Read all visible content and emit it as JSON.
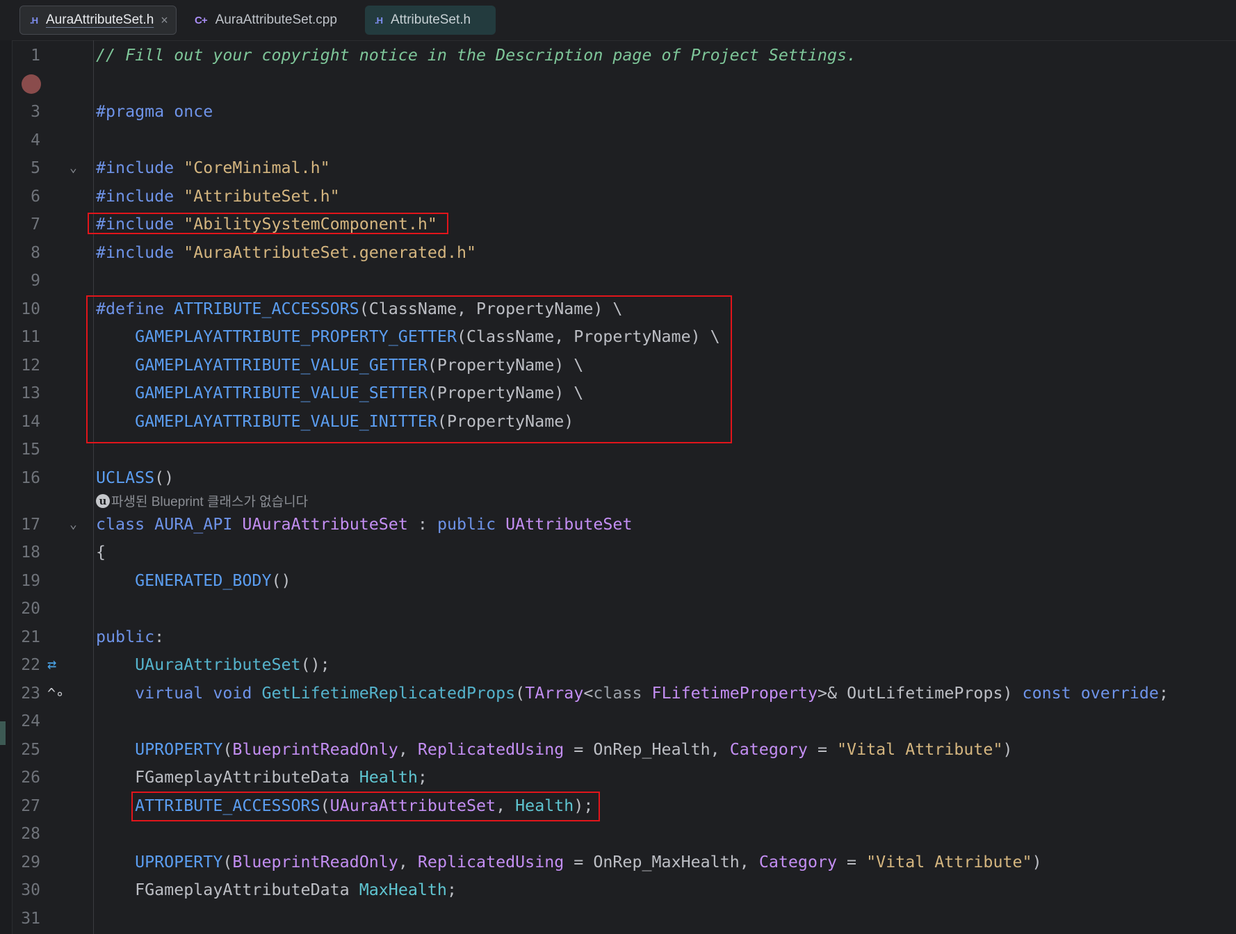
{
  "tabs": [
    {
      "icon": ".H",
      "label": "AuraAttributeSet.h",
      "close": "×",
      "state": "active"
    },
    {
      "icon": "C+",
      "label": "AuraAttributeSet.cpp",
      "state": "normal"
    },
    {
      "icon": ".H",
      "label": "AttributeSet.h",
      "state": "tinted"
    }
  ],
  "colors": {
    "background": "#1e1f22",
    "comment": "#7ec699",
    "keyword": "#6e93e8",
    "string": "#d4b57f",
    "macro": "#5b9df0",
    "type": "#c38ef2",
    "field": "#5fc4d0",
    "highlight_box": "#e1151b"
  },
  "line_numbers": [
    "1",
    "3",
    "4",
    "5",
    "6",
    "7",
    "8",
    "9",
    "10",
    "11",
    "12",
    "13",
    "14",
    "15",
    "16",
    "17",
    "18",
    "19",
    "20",
    "21",
    "22",
    "23",
    "24",
    "25",
    "26",
    "27",
    "28",
    "29",
    "30",
    "31"
  ],
  "gutter_icons": {
    "breakpoint_line": "2",
    "fold_lines": [
      "5",
      "17"
    ],
    "replication_icon_line": "22",
    "override_icon_line": "23"
  },
  "hint": {
    "text": "파생된 Blueprint 클래스가 없습니다",
    "icon": "u-badge-icon"
  },
  "code": {
    "l1": "// Fill out your copyright notice in the Description page of Project Settings.",
    "l3_kw": "#pragma",
    "l3_rest": " once",
    "inc": "#include",
    "l5_str": "\"CoreMinimal.h\"",
    "l6_str": "\"AttributeSet.h\"",
    "l7_str": "\"AbilitySystemComponent.h\"",
    "l8_str": "\"AuraAttributeSet.generated.h\"",
    "l10_kw": "#define",
    "l10_mac": "ATTRIBUTE_ACCESSORS",
    "l10_rest": "(ClassName, PropertyName) \\",
    "l11_mac": "GAMEPLAYATTRIBUTE_PROPERTY_GETTER",
    "l11_rest": "(ClassName, PropertyName) \\",
    "l12_mac": "GAMEPLAYATTRIBUTE_VALUE_GETTER",
    "l12_rest": "(PropertyName) \\",
    "l13_mac": "GAMEPLAYATTRIBUTE_VALUE_SETTER",
    "l13_rest": "(PropertyName) \\",
    "l14_mac": "GAMEPLAYATTRIBUTE_VALUE_INITTER",
    "l14_rest": "(PropertyName)",
    "l16_mac": "UCLASS",
    "l16_rest": "()",
    "l17_kw": "class",
    "l17_api": "AURA_API",
    "l17_cls": "UAuraAttributeSet",
    "l17_colon": " : ",
    "l17_pub": "public",
    "l17_base": "UAttributeSet",
    "l18": "{",
    "l19_mac": "GENERATED_BODY",
    "l19_rest": "()",
    "l21_kw": "public",
    "l21_rest": ":",
    "l22_fn": "UAuraAttributeSet",
    "l22_rest": "();",
    "l23_virt": "virtual",
    "l23_void": "void",
    "l23_fn": "GetLifetimeReplicatedProps",
    "l23_p1": "(",
    "l23_tarr": "TArray",
    "l23_lt": "<",
    "l23_class": "class",
    "l23_flp": "FLifetimeProperty",
    "l23_amp": ">& OutLifetimeProps) ",
    "l23_const": "const",
    "l23_override": "override",
    "l23_semi": ";",
    "l25_mac": "UPROPERTY",
    "l25_p1": "(",
    "l25_bro": "BlueprintReadOnly",
    "l25_c1": ", ",
    "l25_ru": "ReplicatedUsing",
    "l25_eq": " = OnRep_Health, ",
    "l25_cat": "Category",
    "l25_eq2": " = ",
    "l25_str": "\"Vital Attribute\"",
    "l25_end": ")",
    "l26_type": "FGameplayAttributeData",
    "l26_field": "Health",
    "l26_semi": ";",
    "l27_mac": "ATTRIBUTE_ACCESSORS",
    "l27_p1": "(",
    "l27_cls": "UAuraAttributeSet",
    "l27_c": ", ",
    "l27_field": "Health",
    "l27_end": ");",
    "l29_mac": "UPROPERTY",
    "l29_p1": "(",
    "l29_bro": "BlueprintReadOnly",
    "l29_c1": ", ",
    "l29_ru": "ReplicatedUsing",
    "l29_eq": " = OnRep_MaxHealth, ",
    "l29_cat": "Category",
    "l29_eq2": " = ",
    "l29_str": "\"Vital Attribute\"",
    "l29_end": ")",
    "l30_type": "FGameplayAttributeData",
    "l30_field": "MaxHealth",
    "l30_semi": ";"
  }
}
